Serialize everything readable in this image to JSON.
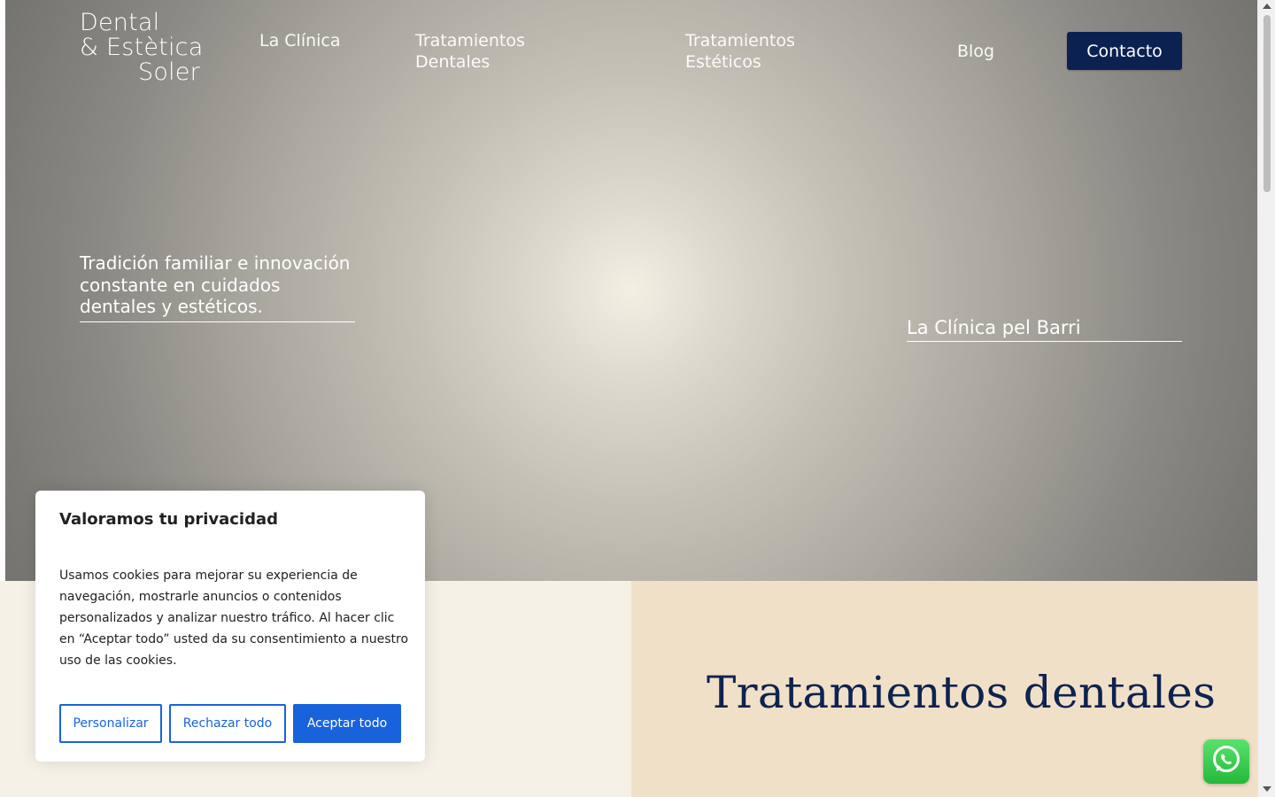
{
  "header": {
    "logo": {
      "line1": "Dental",
      "line2": "& Estètica",
      "line3": "Soler"
    },
    "nav": [
      {
        "label": "La Clínica"
      },
      {
        "label": "Tratamientos Dentales"
      },
      {
        "label": "Tratamientos Estéticos"
      },
      {
        "label": "Blog"
      }
    ],
    "contact_label": "Contacto"
  },
  "hero": {
    "tagline": "Tradición familiar e innovación constante en cuidados dentales y estéticos.",
    "barri": "La Clínica pel Barri"
  },
  "sections": {
    "dental_title": "Tratamientos dentales"
  },
  "cookie_banner": {
    "title": "Valoramos tu privacidad",
    "text": "Usamos cookies para mejorar su experiencia de navegación, mostrarle anuncios o contenidos personalizados y analizar nuestro tráfico. Al hacer clic en “Aceptar todo” usted da su consentimiento a nuestro uso de las cookies.",
    "customize_label": "Personalizar",
    "reject_label": "Rechazar todo",
    "accept_label": "Aceptar todo"
  },
  "colors": {
    "brand_navy": "#0b2150",
    "cookie_blue": "#1863dc",
    "cream": "#f5f1e7",
    "beige": "#f1e0c8",
    "whatsapp_green": "#25d366"
  },
  "icons": {
    "whatsapp": "whatsapp-icon"
  }
}
